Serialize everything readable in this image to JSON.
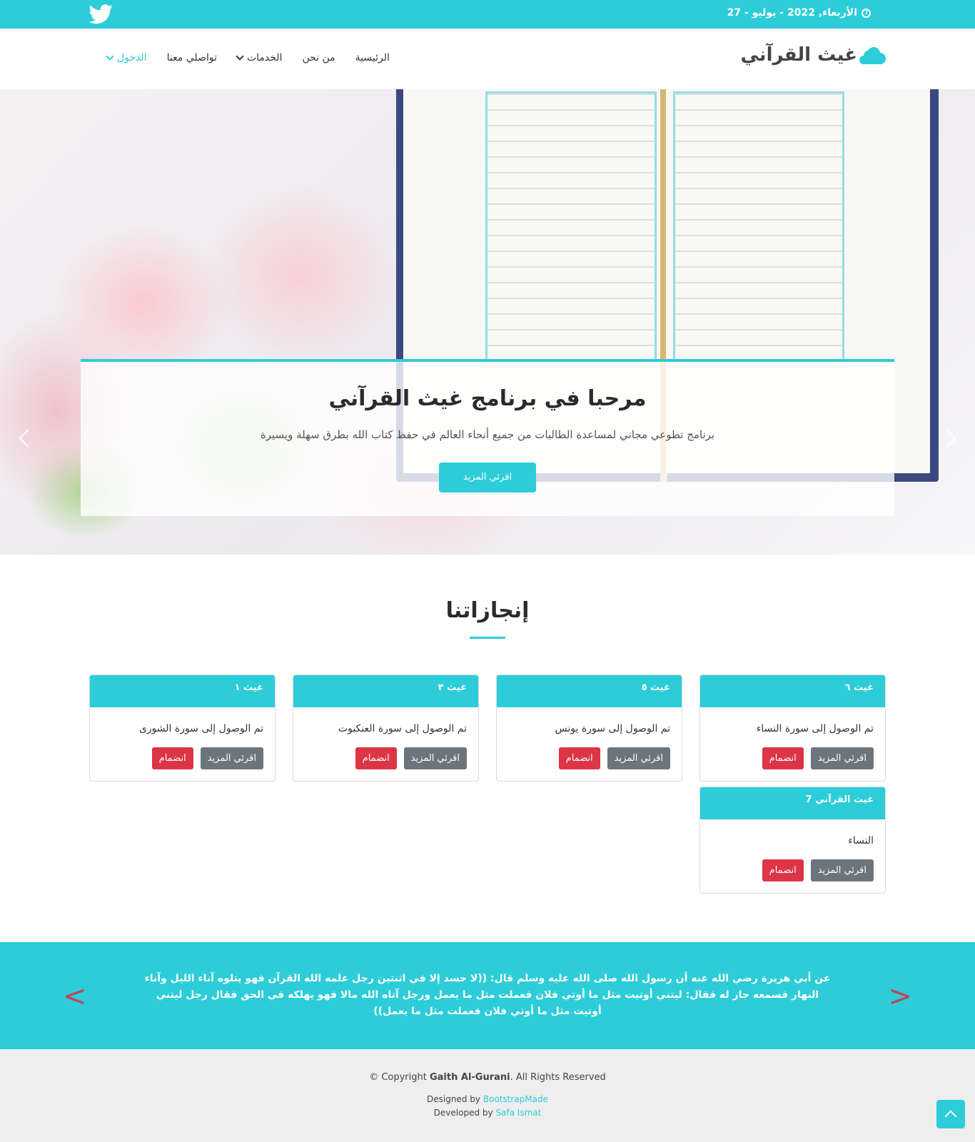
{
  "topbar": {
    "date": "الأربعاء, 2022 - يوليو - 27",
    "twitter_icon": "twitter-icon",
    "clock_icon": "clock-icon"
  },
  "header": {
    "logo_text": "غيث القرآني",
    "logo_icon": "cloud-icon",
    "nav": [
      {
        "label": "الرئيسية"
      },
      {
        "label": "من نحن"
      },
      {
        "label": "الخدمات"
      },
      {
        "label": "تواصلي معنا"
      },
      {
        "label": "الدخول"
      }
    ]
  },
  "hero": {
    "title": "مرحبا في برنامج غيث القرآني",
    "subtitle": "برنامج تطوعي مجاني لمساعدة الطالبات من جميع أنحاء العالم في حفظ كتاب الله بطرق سهلة ويسيرة",
    "button": "اقرئي المزيد"
  },
  "achievements": {
    "title": "إنجازاتنا",
    "cards": [
      {
        "head": "غيث ٦",
        "text": "تم الوصول إلى سورة النساء",
        "more": "اقرئي المزيد",
        "join": "انضمام"
      },
      {
        "head": "غيث ٥",
        "text": "تم الوصول إلى سورة يونس",
        "more": "اقرئي المزيد",
        "join": "انضمام"
      },
      {
        "head": "غيث ٣",
        "text": "تم الوصول إلى سورة العنكبوت",
        "more": "اقرئي المزيد",
        "join": "انضمام"
      },
      {
        "head": "غيث ١",
        "text": "تم الوصول إلى سورة الشورى",
        "more": "اقرئي المزيد",
        "join": "انضمام"
      },
      {
        "head": "غيث القرآني 7",
        "text": "النساء",
        "more": "اقرئي المزيد",
        "join": "انضمام"
      }
    ]
  },
  "hadith": {
    "text": "عن أبي هريرة رضي الله عنه أن رسول الله صلى الله عليه وسلم قال: ((لا حسد إلا في اثنتين رجل علمه الله القرآن فهو يتلوه آناء الليل وآناء النهار فسمعه جار له فقال: ليتني أوتيت مثل ما أوتي فلان فعملت مثل ما يعمل ورجل آتاه الله مالا فهو يهلكه في الحق فقال رجل ليتني أوتيت مثل ما أوتي فلان فعملت مثل ما يعمل))",
    "prev": "<",
    "next": ">"
  },
  "footer": {
    "copy_prefix": "© Copyright ",
    "copy_name": "Gaith Al-Gurani",
    "copy_suffix": ". All Rights Reserved",
    "designed_prefix": "Designed by ",
    "designed_by": "BootstrapMade",
    "developed_prefix": "Developed by ",
    "developed_by": "Safa Ismat"
  },
  "colors": {
    "accent": "#2ccdd8",
    "danger": "#dc3545",
    "secondary": "#6c757d"
  }
}
